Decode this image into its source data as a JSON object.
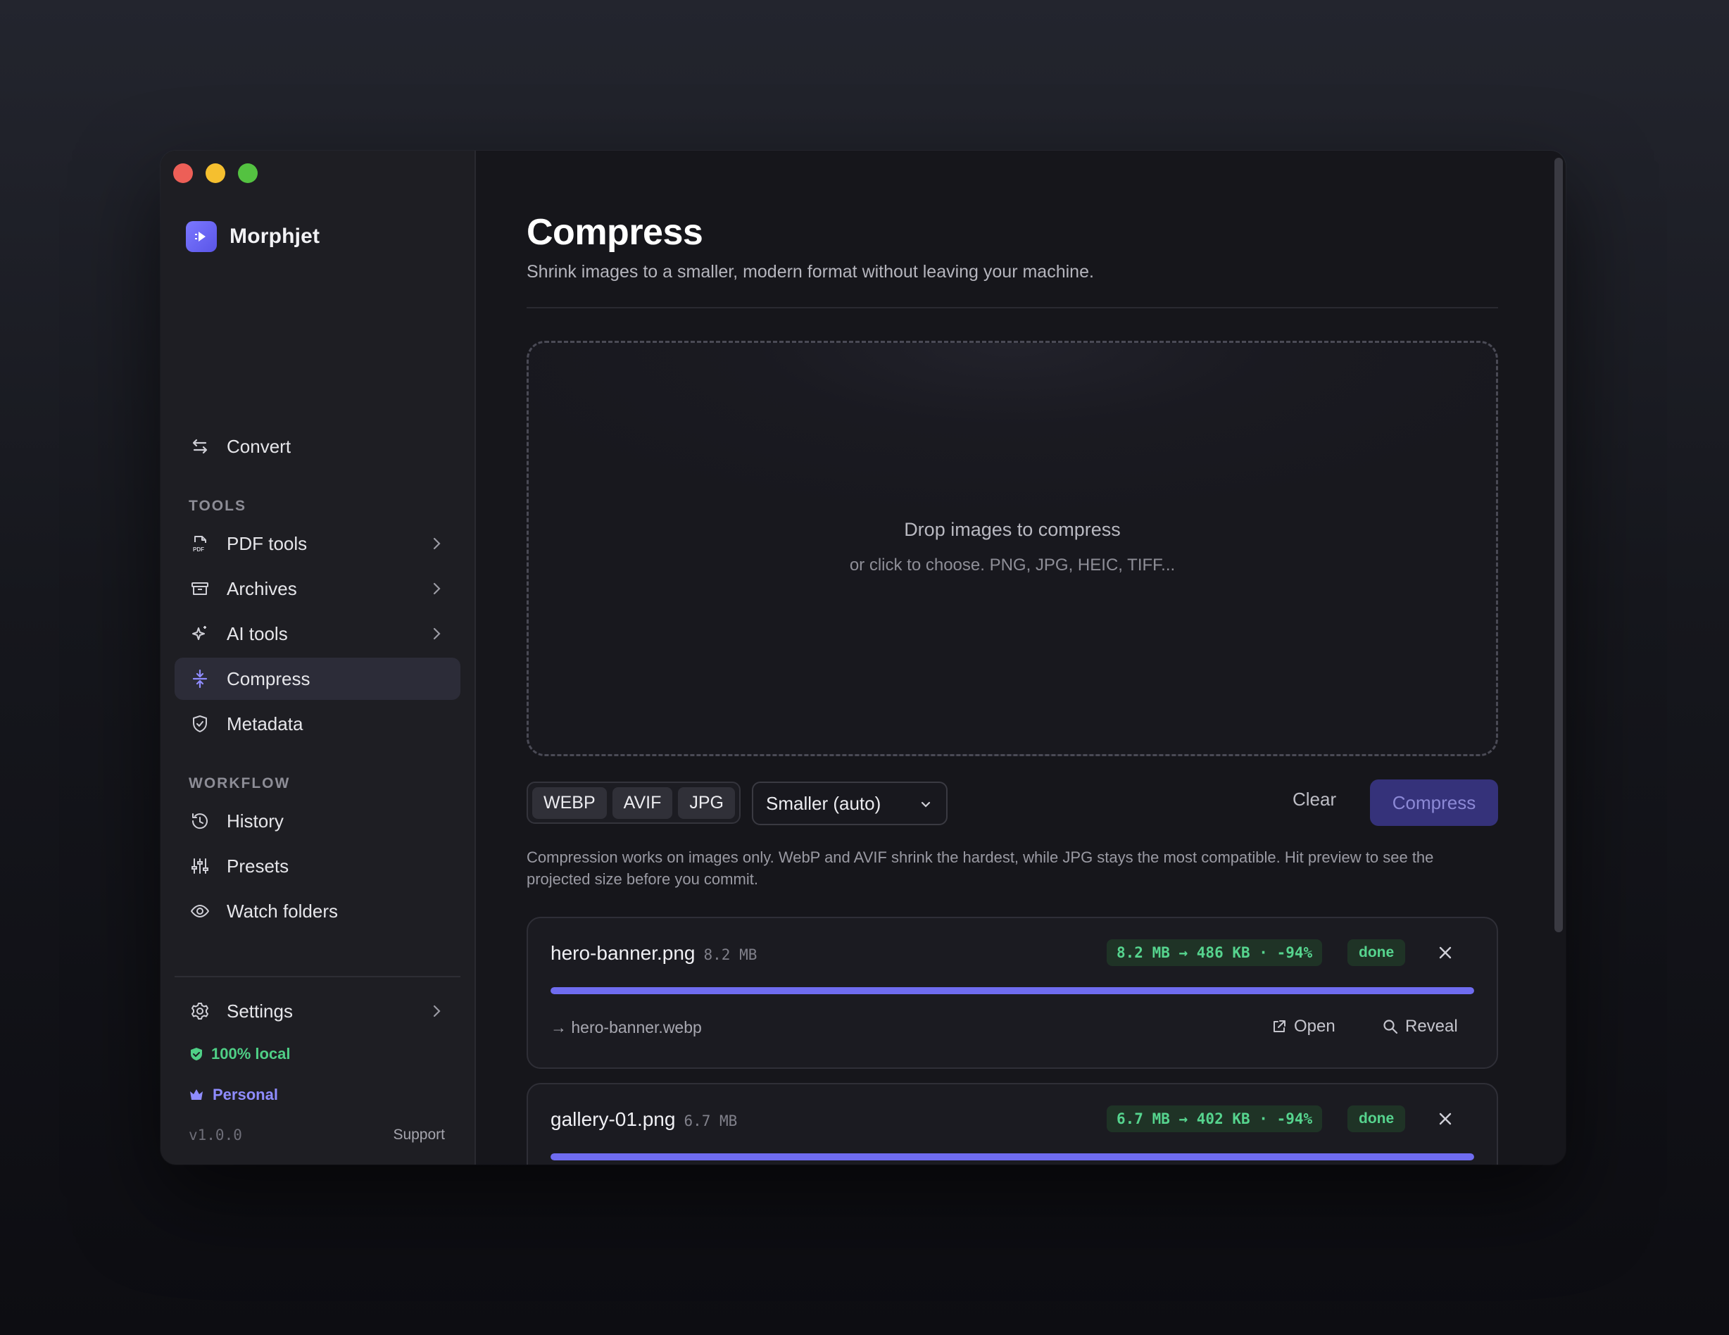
{
  "app": {
    "name": "Morphjet"
  },
  "sidebar": {
    "top_item": {
      "label": "Convert",
      "icon": "arrows-swap-icon"
    },
    "tools_label": "TOOLS",
    "tools": [
      {
        "label": "PDF tools",
        "icon": "pdf-file-icon",
        "has_submenu": true
      },
      {
        "label": "Archives",
        "icon": "archive-box-icon",
        "has_submenu": true
      },
      {
        "label": "AI tools",
        "icon": "sparkle-icon",
        "has_submenu": true
      },
      {
        "label": "Compress",
        "icon": "compress-icon",
        "active": true
      },
      {
        "label": "Metadata",
        "icon": "shield-check-icon"
      }
    ],
    "workflow_label": "WORKFLOW",
    "workflow": [
      {
        "label": "History",
        "icon": "history-icon"
      },
      {
        "label": "Presets",
        "icon": "sliders-icon"
      },
      {
        "label": "Watch folders",
        "icon": "eye-icon"
      }
    ],
    "settings": {
      "label": "Settings",
      "icon": "gear-icon"
    },
    "local_badge": "100% local",
    "plan_badge": "Personal",
    "version": "v1.0.0",
    "support": "Support"
  },
  "main": {
    "title": "Compress",
    "subtitle": "Shrink images to a smaller, modern format without leaving your machine.",
    "dropzone": {
      "title": "Drop images to compress",
      "subtitle": "or click to choose. PNG, JPG, HEIC, TIFF..."
    },
    "formats": [
      "WEBP",
      "AVIF",
      "JPG"
    ],
    "quality_select": "Smaller (auto)",
    "clear_label": "Clear",
    "compress_label": "Compress",
    "help_text": "Compression works on images only. WebP and AVIF shrink the hardest, while JPG stays the most compatible. Hit preview to see the projected size before you commit.",
    "files": [
      {
        "name": "hero-banner.png",
        "size": "8.2 MB",
        "stats": "8.2 MB → 486 KB · -94%",
        "status": "done",
        "progress": 1.0,
        "output": "→ hero-banner.webp",
        "open_label": "Open",
        "reveal_label": "Reveal"
      },
      {
        "name": "gallery-01.png",
        "size": "6.7 MB",
        "stats": "6.7 MB → 402 KB · -94%",
        "status": "done",
        "progress": 1.0
      }
    ]
  },
  "colors": {
    "accent": "#6f6cf0",
    "success": "#56d48e",
    "plan": "#8f8cff"
  }
}
